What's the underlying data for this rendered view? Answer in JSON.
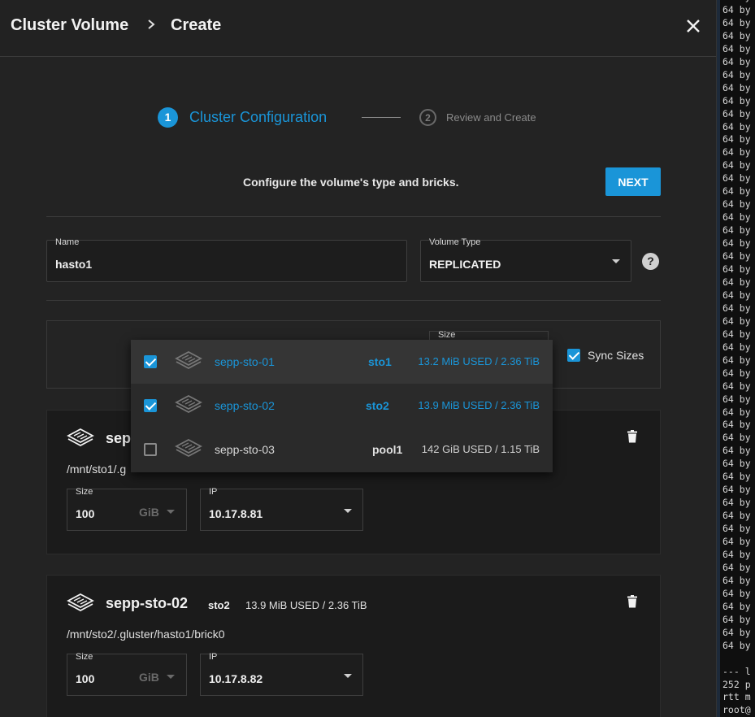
{
  "header": {
    "crumb_1": "Cluster Volume",
    "crumb_separator": ">",
    "crumb_2": "Create",
    "close_icon": "close-icon"
  },
  "stepper": {
    "step1_number": "1",
    "step1_label": "Cluster Configuration",
    "step2_number": "2",
    "step2_label": "Review and Create"
  },
  "instruction": "Configure the volume's type and bricks.",
  "next_label": "NEXT",
  "form": {
    "name_label": "Name",
    "name_value": "hasto1",
    "volume_type_label": "Volume Type",
    "volume_type_value": "REPLICATED",
    "help_glyph": "?"
  },
  "brick_row": {
    "size_label": "Size",
    "sync_label": "Sync Sizes",
    "sync_checked": true
  },
  "dropdown": {
    "items": [
      {
        "host": "sepp-sto-01",
        "pool": "sto1",
        "usage": "13.2 MiB USED / 2.36 TiB",
        "checked": true
      },
      {
        "host": "sepp-sto-02",
        "pool": "sto2",
        "usage": "13.9 MiB USED / 2.36 TiB",
        "checked": true
      },
      {
        "host": "sepp-sto-03",
        "pool": "pool1",
        "usage": "142 GiB USED / 1.15 TiB",
        "checked": false
      }
    ]
  },
  "bricks": [
    {
      "host": "sepp-sto-01",
      "host_visible": "sepp",
      "path": "/mnt/sto1/.g",
      "size_label": "Size",
      "size_value": "100",
      "size_unit": "GiB",
      "ip_label": "IP",
      "ip_value": "10.17.8.81"
    },
    {
      "host": "sepp-sto-02",
      "pool": "sto2",
      "usage": "13.9 MiB USED / 2.36 TiB",
      "path": "/mnt/sto2/.gluster/hasto1/brick0",
      "size_label": "Size",
      "size_value": "100",
      "size_unit": "GiB",
      "ip_label": "IP",
      "ip_value": "10.17.8.82"
    }
  ],
  "terminal": {
    "lines": [
      "64 by",
      "64 by",
      "64 by",
      "64 by",
      "64 by",
      "64 by",
      "64 by",
      "64 by",
      "64 by",
      "64 by",
      "64 by",
      "64 by",
      "64 by",
      "64 by",
      "64 by",
      "64 by",
      "64 by",
      "64 by",
      "64 by",
      "64 by",
      "64 by",
      "64 by",
      "64 by",
      "64 by",
      "64 by",
      "64 by",
      "64 by",
      "64 by",
      "64 by",
      "64 by",
      "64 by",
      "64 by",
      "64 by",
      "64 by",
      "64 by",
      "64 by",
      "64 by",
      "64 by",
      "64 by",
      "64 by",
      "64 by",
      "64 by",
      "64 by",
      "64 by",
      "64 by",
      "64 by",
      "64 by",
      "64 by",
      "64 by",
      "64 by",
      "64 by",
      "",
      "--- l",
      "252 p",
      "rtt m",
      "root@"
    ]
  },
  "colors": {
    "accent": "#1a95d8",
    "background": "#232323",
    "card": "#1b1b1b"
  }
}
